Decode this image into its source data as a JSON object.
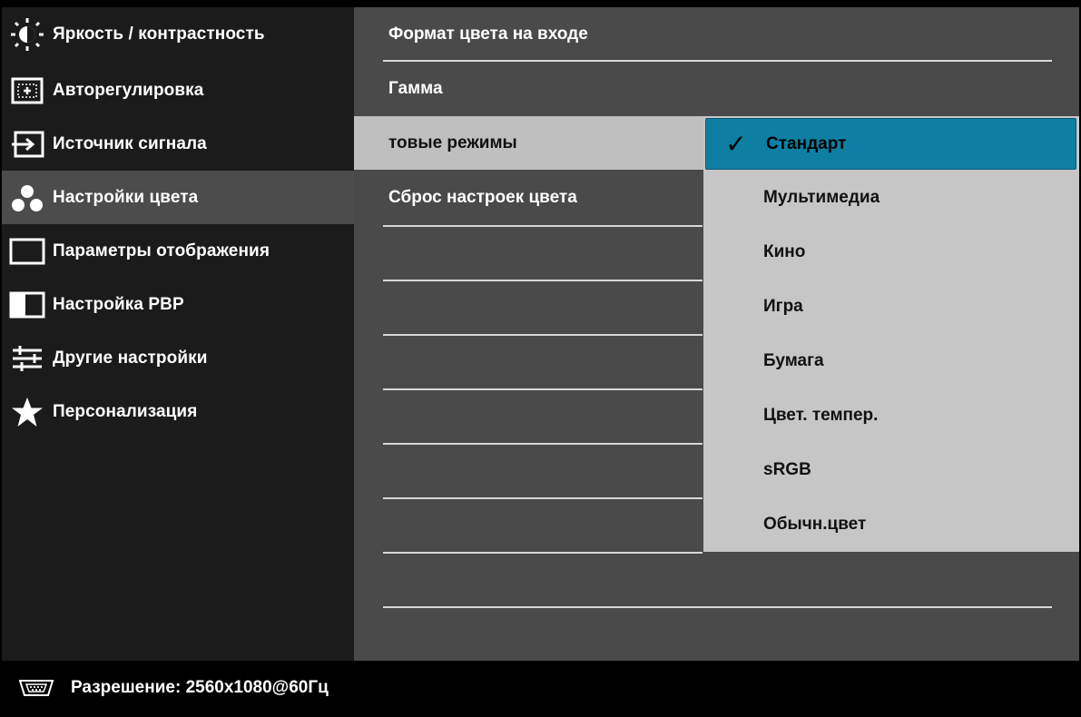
{
  "left_menu": {
    "items": [
      {
        "label": "Яркость / контрастность",
        "icon": "brightness-icon"
      },
      {
        "label": "Авторегулировка",
        "icon": "auto-adjust-icon"
      },
      {
        "label": "Источник сигнала",
        "icon": "input-source-icon"
      },
      {
        "label": "Настройки цвета",
        "icon": "color-settings-icon"
      },
      {
        "label": "Параметры отображения",
        "icon": "display-settings-icon"
      },
      {
        "label": "Настройка PBP",
        "icon": "pbp-icon"
      },
      {
        "label": "Другие настройки",
        "icon": "other-settings-icon"
      },
      {
        "label": "Персонализация",
        "icon": "star-icon"
      }
    ],
    "active_index": 3
  },
  "middle_menu": {
    "items": [
      {
        "label": "Формат цвета на входе"
      },
      {
        "label": "Гамма"
      },
      {
        "label": "товые режимы"
      },
      {
        "label": "Сброс настроек цвета"
      }
    ],
    "selected_index": 2
  },
  "submenu": {
    "items": [
      {
        "label": "Стандарт"
      },
      {
        "label": "Мультимедиа"
      },
      {
        "label": "Кино"
      },
      {
        "label": "Игра"
      },
      {
        "label": "Бумага"
      },
      {
        "label": "Цвет. темпер."
      },
      {
        "label": "sRGB"
      },
      {
        "label": "Обычн.цвет"
      }
    ],
    "selected_index": 0,
    "check_glyph": "✓"
  },
  "status_bar": {
    "text": "Разрешение: 2560x1080@60Гц",
    "icon": "vga-connector-icon"
  },
  "colors": {
    "selected_highlight": "#0e7fa3",
    "submenu_bg": "#c6c6c6",
    "active_left": "#4c4c4c"
  }
}
